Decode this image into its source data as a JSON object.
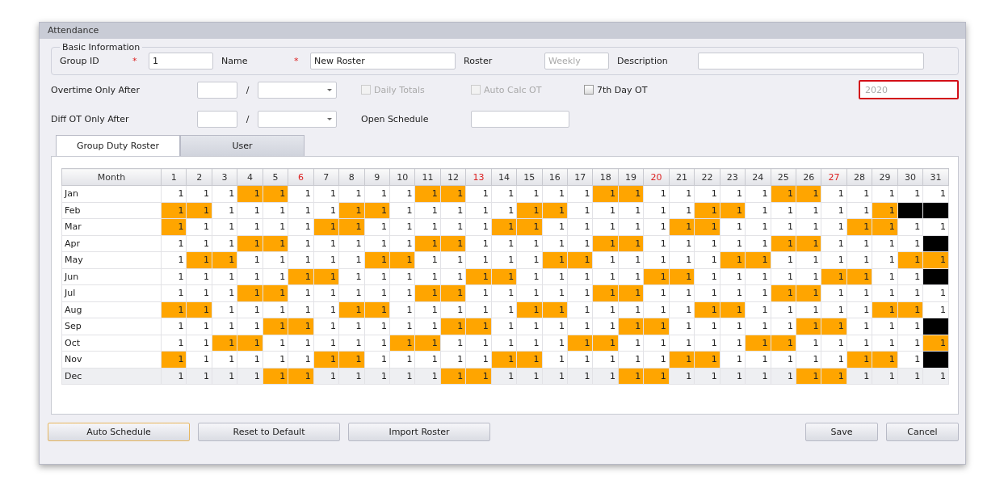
{
  "window": {
    "title": "Attendance"
  },
  "basic_information": {
    "legend": "Basic Information",
    "fields": [
      {
        "label": "Group ID",
        "required_mark": "*",
        "value": "1"
      },
      {
        "label": "Name",
        "required_mark": "*",
        "value": "New Roster"
      },
      {
        "label": "Roster",
        "placeholder": "Weekly"
      },
      {
        "label": "Description"
      }
    ]
  },
  "overtime_row": {
    "label": "Overtime Only After",
    "separator": "/",
    "checkboxes": [
      {
        "label": "Daily Totals",
        "checked": false,
        "disabled": true
      },
      {
        "label": "Auto Calc OT",
        "checked": false,
        "disabled": true
      },
      {
        "label": "7th Day OT",
        "checked": false,
        "disabled": false
      }
    ],
    "year_dropdown": {
      "value": "2020",
      "disabled": true,
      "highlighted": true
    }
  },
  "diff_ot_row": {
    "label": "Diff OT Only After",
    "separator": "/",
    "open_schedule_label": "Open Schedule"
  },
  "tabs": [
    {
      "label": "Group Duty Roster",
      "selected": true
    },
    {
      "label": "User",
      "selected": false
    }
  ],
  "roster_table": {
    "month_header": "Month",
    "days": [
      {
        "label": "1",
        "highlight": false
      },
      {
        "label": "2",
        "highlight": false
      },
      {
        "label": "3",
        "highlight": false
      },
      {
        "label": "4",
        "highlight": false
      },
      {
        "label": "5",
        "highlight": false
      },
      {
        "label": "6",
        "highlight": true
      },
      {
        "label": "7",
        "highlight": false
      },
      {
        "label": "8",
        "highlight": false
      },
      {
        "label": "9",
        "highlight": false
      },
      {
        "label": "10",
        "highlight": false
      },
      {
        "label": "11",
        "highlight": false
      },
      {
        "label": "12",
        "highlight": false
      },
      {
        "label": "13",
        "highlight": true
      },
      {
        "label": "14",
        "highlight": false
      },
      {
        "label": "15",
        "highlight": false
      },
      {
        "label": "16",
        "highlight": false
      },
      {
        "label": "17",
        "highlight": false
      },
      {
        "label": "18",
        "highlight": false
      },
      {
        "label": "19",
        "highlight": false
      },
      {
        "label": "20",
        "highlight": true
      },
      {
        "label": "21",
        "highlight": false
      },
      {
        "label": "22",
        "highlight": false
      },
      {
        "label": "23",
        "highlight": false
      },
      {
        "label": "24",
        "highlight": false
      },
      {
        "label": "25",
        "highlight": false
      },
      {
        "label": "26",
        "highlight": false
      },
      {
        "label": "27",
        "highlight": true
      },
      {
        "label": "28",
        "highlight": false
      },
      {
        "label": "29",
        "highlight": false
      },
      {
        "label": "30",
        "highlight": false
      },
      {
        "label": "31",
        "highlight": false
      }
    ],
    "rows": [
      {
        "month": "Jan",
        "selected": false,
        "cells": [
          {
            "text": "1",
            "kind": "work"
          },
          {
            "text": "1",
            "kind": "work"
          },
          {
            "text": "1",
            "kind": "work"
          },
          {
            "text": "1",
            "kind": "off"
          },
          {
            "text": "1",
            "kind": "off"
          },
          {
            "text": "1",
            "kind": "work"
          },
          {
            "text": "1",
            "kind": "work"
          },
          {
            "text": "1",
            "kind": "work"
          },
          {
            "text": "1",
            "kind": "work"
          },
          {
            "text": "1",
            "kind": "work"
          },
          {
            "text": "1",
            "kind": "off"
          },
          {
            "text": "1",
            "kind": "off"
          },
          {
            "text": "1",
            "kind": "work"
          },
          {
            "text": "1",
            "kind": "work"
          },
          {
            "text": "1",
            "kind": "work"
          },
          {
            "text": "1",
            "kind": "work"
          },
          {
            "text": "1",
            "kind": "work"
          },
          {
            "text": "1",
            "kind": "off"
          },
          {
            "text": "1",
            "kind": "off"
          },
          {
            "text": "1",
            "kind": "work"
          },
          {
            "text": "1",
            "kind": "work"
          },
          {
            "text": "1",
            "kind": "work"
          },
          {
            "text": "1",
            "kind": "work"
          },
          {
            "text": "1",
            "kind": "work"
          },
          {
            "text": "1",
            "kind": "off"
          },
          {
            "text": "1",
            "kind": "off"
          },
          {
            "text": "1",
            "kind": "work"
          },
          {
            "text": "1",
            "kind": "work"
          },
          {
            "text": "1",
            "kind": "work"
          },
          {
            "text": "1",
            "kind": "work"
          },
          {
            "text": "1",
            "kind": "work"
          }
        ]
      },
      {
        "month": "Feb",
        "selected": false,
        "cells": [
          {
            "text": "1",
            "kind": "off"
          },
          {
            "text": "1",
            "kind": "off"
          },
          {
            "text": "1",
            "kind": "work"
          },
          {
            "text": "1",
            "kind": "work"
          },
          {
            "text": "1",
            "kind": "work"
          },
          {
            "text": "1",
            "kind": "work"
          },
          {
            "text": "1",
            "kind": "work"
          },
          {
            "text": "1",
            "kind": "off"
          },
          {
            "text": "1",
            "kind": "off"
          },
          {
            "text": "1",
            "kind": "work"
          },
          {
            "text": "1",
            "kind": "work"
          },
          {
            "text": "1",
            "kind": "work"
          },
          {
            "text": "1",
            "kind": "work"
          },
          {
            "text": "1",
            "kind": "work"
          },
          {
            "text": "1",
            "kind": "off"
          },
          {
            "text": "1",
            "kind": "off"
          },
          {
            "text": "1",
            "kind": "work"
          },
          {
            "text": "1",
            "kind": "work"
          },
          {
            "text": "1",
            "kind": "work"
          },
          {
            "text": "1",
            "kind": "work"
          },
          {
            "text": "1",
            "kind": "work"
          },
          {
            "text": "1",
            "kind": "off"
          },
          {
            "text": "1",
            "kind": "off"
          },
          {
            "text": "1",
            "kind": "work"
          },
          {
            "text": "1",
            "kind": "work"
          },
          {
            "text": "1",
            "kind": "work"
          },
          {
            "text": "1",
            "kind": "work"
          },
          {
            "text": "1",
            "kind": "work"
          },
          {
            "text": "1",
            "kind": "off"
          },
          {
            "kind": "none"
          },
          {
            "kind": "none"
          }
        ]
      },
      {
        "month": "Mar",
        "selected": false,
        "cells": [
          {
            "text": "1",
            "kind": "off"
          },
          {
            "text": "1",
            "kind": "work"
          },
          {
            "text": "1",
            "kind": "work"
          },
          {
            "text": "1",
            "kind": "work"
          },
          {
            "text": "1",
            "kind": "work"
          },
          {
            "text": "1",
            "kind": "work"
          },
          {
            "text": "1",
            "kind": "off"
          },
          {
            "text": "1",
            "kind": "off"
          },
          {
            "text": "1",
            "kind": "work"
          },
          {
            "text": "1",
            "kind": "work"
          },
          {
            "text": "1",
            "kind": "work"
          },
          {
            "text": "1",
            "kind": "work"
          },
          {
            "text": "1",
            "kind": "work"
          },
          {
            "text": "1",
            "kind": "off"
          },
          {
            "text": "1",
            "kind": "off"
          },
          {
            "text": "1",
            "kind": "work"
          },
          {
            "text": "1",
            "kind": "work"
          },
          {
            "text": "1",
            "kind": "work"
          },
          {
            "text": "1",
            "kind": "work"
          },
          {
            "text": "1",
            "kind": "work"
          },
          {
            "text": "1",
            "kind": "off"
          },
          {
            "text": "1",
            "kind": "off"
          },
          {
            "text": "1",
            "kind": "work"
          },
          {
            "text": "1",
            "kind": "work"
          },
          {
            "text": "1",
            "kind": "work"
          },
          {
            "text": "1",
            "kind": "work"
          },
          {
            "text": "1",
            "kind": "work"
          },
          {
            "text": "1",
            "kind": "off"
          },
          {
            "text": "1",
            "kind": "off"
          },
          {
            "text": "1",
            "kind": "work"
          },
          {
            "text": "1",
            "kind": "work"
          }
        ]
      },
      {
        "month": "Apr",
        "selected": false,
        "cells": [
          {
            "text": "1",
            "kind": "work"
          },
          {
            "text": "1",
            "kind": "work"
          },
          {
            "text": "1",
            "kind": "work"
          },
          {
            "text": "1",
            "kind": "off"
          },
          {
            "text": "1",
            "kind": "off"
          },
          {
            "text": "1",
            "kind": "work"
          },
          {
            "text": "1",
            "kind": "work"
          },
          {
            "text": "1",
            "kind": "work"
          },
          {
            "text": "1",
            "kind": "work"
          },
          {
            "text": "1",
            "kind": "work"
          },
          {
            "text": "1",
            "kind": "off"
          },
          {
            "text": "1",
            "kind": "off"
          },
          {
            "text": "1",
            "kind": "work"
          },
          {
            "text": "1",
            "kind": "work"
          },
          {
            "text": "1",
            "kind": "work"
          },
          {
            "text": "1",
            "kind": "work"
          },
          {
            "text": "1",
            "kind": "work"
          },
          {
            "text": "1",
            "kind": "off"
          },
          {
            "text": "1",
            "kind": "off"
          },
          {
            "text": "1",
            "kind": "work"
          },
          {
            "text": "1",
            "kind": "work"
          },
          {
            "text": "1",
            "kind": "work"
          },
          {
            "text": "1",
            "kind": "work"
          },
          {
            "text": "1",
            "kind": "work"
          },
          {
            "text": "1",
            "kind": "off"
          },
          {
            "text": "1",
            "kind": "off"
          },
          {
            "text": "1",
            "kind": "work"
          },
          {
            "text": "1",
            "kind": "work"
          },
          {
            "text": "1",
            "kind": "work"
          },
          {
            "text": "1",
            "kind": "work"
          },
          {
            "kind": "none"
          }
        ]
      },
      {
        "month": "May",
        "selected": false,
        "cells": [
          {
            "text": "1",
            "kind": "work"
          },
          {
            "text": "1",
            "kind": "off"
          },
          {
            "text": "1",
            "kind": "off"
          },
          {
            "text": "1",
            "kind": "work"
          },
          {
            "text": "1",
            "kind": "work"
          },
          {
            "text": "1",
            "kind": "work"
          },
          {
            "text": "1",
            "kind": "work"
          },
          {
            "text": "1",
            "kind": "work"
          },
          {
            "text": "1",
            "kind": "off"
          },
          {
            "text": "1",
            "kind": "off"
          },
          {
            "text": "1",
            "kind": "work"
          },
          {
            "text": "1",
            "kind": "work"
          },
          {
            "text": "1",
            "kind": "work"
          },
          {
            "text": "1",
            "kind": "work"
          },
          {
            "text": "1",
            "kind": "work"
          },
          {
            "text": "1",
            "kind": "off"
          },
          {
            "text": "1",
            "kind": "off"
          },
          {
            "text": "1",
            "kind": "work"
          },
          {
            "text": "1",
            "kind": "work"
          },
          {
            "text": "1",
            "kind": "work"
          },
          {
            "text": "1",
            "kind": "work"
          },
          {
            "text": "1",
            "kind": "work"
          },
          {
            "text": "1",
            "kind": "off"
          },
          {
            "text": "1",
            "kind": "off"
          },
          {
            "text": "1",
            "kind": "work"
          },
          {
            "text": "1",
            "kind": "work"
          },
          {
            "text": "1",
            "kind": "work"
          },
          {
            "text": "1",
            "kind": "work"
          },
          {
            "text": "1",
            "kind": "work"
          },
          {
            "text": "1",
            "kind": "off"
          },
          {
            "text": "1",
            "kind": "off"
          }
        ]
      },
      {
        "month": "Jun",
        "selected": false,
        "cells": [
          {
            "text": "1",
            "kind": "work"
          },
          {
            "text": "1",
            "kind": "work"
          },
          {
            "text": "1",
            "kind": "work"
          },
          {
            "text": "1",
            "kind": "work"
          },
          {
            "text": "1",
            "kind": "work"
          },
          {
            "text": "1",
            "kind": "off"
          },
          {
            "text": "1",
            "kind": "off"
          },
          {
            "text": "1",
            "kind": "work"
          },
          {
            "text": "1",
            "kind": "work"
          },
          {
            "text": "1",
            "kind": "work"
          },
          {
            "text": "1",
            "kind": "work"
          },
          {
            "text": "1",
            "kind": "work"
          },
          {
            "text": "1",
            "kind": "off"
          },
          {
            "text": "1",
            "kind": "off"
          },
          {
            "text": "1",
            "kind": "work"
          },
          {
            "text": "1",
            "kind": "work"
          },
          {
            "text": "1",
            "kind": "work"
          },
          {
            "text": "1",
            "kind": "work"
          },
          {
            "text": "1",
            "kind": "work"
          },
          {
            "text": "1",
            "kind": "off"
          },
          {
            "text": "1",
            "kind": "off"
          },
          {
            "text": "1",
            "kind": "work"
          },
          {
            "text": "1",
            "kind": "work"
          },
          {
            "text": "1",
            "kind": "work"
          },
          {
            "text": "1",
            "kind": "work"
          },
          {
            "text": "1",
            "kind": "work"
          },
          {
            "text": "1",
            "kind": "off"
          },
          {
            "text": "1",
            "kind": "off"
          },
          {
            "text": "1",
            "kind": "work"
          },
          {
            "text": "1",
            "kind": "work"
          },
          {
            "kind": "none"
          }
        ]
      },
      {
        "month": "Jul",
        "selected": false,
        "cells": [
          {
            "text": "1",
            "kind": "work"
          },
          {
            "text": "1",
            "kind": "work"
          },
          {
            "text": "1",
            "kind": "work"
          },
          {
            "text": "1",
            "kind": "off"
          },
          {
            "text": "1",
            "kind": "off"
          },
          {
            "text": "1",
            "kind": "work"
          },
          {
            "text": "1",
            "kind": "work"
          },
          {
            "text": "1",
            "kind": "work"
          },
          {
            "text": "1",
            "kind": "work"
          },
          {
            "text": "1",
            "kind": "work"
          },
          {
            "text": "1",
            "kind": "off"
          },
          {
            "text": "1",
            "kind": "off"
          },
          {
            "text": "1",
            "kind": "work"
          },
          {
            "text": "1",
            "kind": "work"
          },
          {
            "text": "1",
            "kind": "work"
          },
          {
            "text": "1",
            "kind": "work"
          },
          {
            "text": "1",
            "kind": "work"
          },
          {
            "text": "1",
            "kind": "off"
          },
          {
            "text": "1",
            "kind": "off"
          },
          {
            "text": "1",
            "kind": "work"
          },
          {
            "text": "1",
            "kind": "work"
          },
          {
            "text": "1",
            "kind": "work"
          },
          {
            "text": "1",
            "kind": "work"
          },
          {
            "text": "1",
            "kind": "work"
          },
          {
            "text": "1",
            "kind": "off"
          },
          {
            "text": "1",
            "kind": "off"
          },
          {
            "text": "1",
            "kind": "work"
          },
          {
            "text": "1",
            "kind": "work"
          },
          {
            "text": "1",
            "kind": "work"
          },
          {
            "text": "1",
            "kind": "work"
          },
          {
            "text": "1",
            "kind": "work"
          }
        ]
      },
      {
        "month": "Aug",
        "selected": false,
        "cells": [
          {
            "text": "1",
            "kind": "off"
          },
          {
            "text": "1",
            "kind": "off"
          },
          {
            "text": "1",
            "kind": "work"
          },
          {
            "text": "1",
            "kind": "work"
          },
          {
            "text": "1",
            "kind": "work"
          },
          {
            "text": "1",
            "kind": "work"
          },
          {
            "text": "1",
            "kind": "work"
          },
          {
            "text": "1",
            "kind": "off"
          },
          {
            "text": "1",
            "kind": "off"
          },
          {
            "text": "1",
            "kind": "work"
          },
          {
            "text": "1",
            "kind": "work"
          },
          {
            "text": "1",
            "kind": "work"
          },
          {
            "text": "1",
            "kind": "work"
          },
          {
            "text": "1",
            "kind": "work"
          },
          {
            "text": "1",
            "kind": "off"
          },
          {
            "text": "1",
            "kind": "off"
          },
          {
            "text": "1",
            "kind": "work"
          },
          {
            "text": "1",
            "kind": "work"
          },
          {
            "text": "1",
            "kind": "work"
          },
          {
            "text": "1",
            "kind": "work"
          },
          {
            "text": "1",
            "kind": "work"
          },
          {
            "text": "1",
            "kind": "off"
          },
          {
            "text": "1",
            "kind": "off"
          },
          {
            "text": "1",
            "kind": "work"
          },
          {
            "text": "1",
            "kind": "work"
          },
          {
            "text": "1",
            "kind": "work"
          },
          {
            "text": "1",
            "kind": "work"
          },
          {
            "text": "1",
            "kind": "work"
          },
          {
            "text": "1",
            "kind": "off"
          },
          {
            "text": "1",
            "kind": "off"
          },
          {
            "text": "1",
            "kind": "work"
          }
        ]
      },
      {
        "month": "Sep",
        "selected": false,
        "cells": [
          {
            "text": "1",
            "kind": "work"
          },
          {
            "text": "1",
            "kind": "work"
          },
          {
            "text": "1",
            "kind": "work"
          },
          {
            "text": "1",
            "kind": "work"
          },
          {
            "text": "1",
            "kind": "off"
          },
          {
            "text": "1",
            "kind": "off"
          },
          {
            "text": "1",
            "kind": "work"
          },
          {
            "text": "1",
            "kind": "work"
          },
          {
            "text": "1",
            "kind": "work"
          },
          {
            "text": "1",
            "kind": "work"
          },
          {
            "text": "1",
            "kind": "work"
          },
          {
            "text": "1",
            "kind": "off"
          },
          {
            "text": "1",
            "kind": "off"
          },
          {
            "text": "1",
            "kind": "work"
          },
          {
            "text": "1",
            "kind": "work"
          },
          {
            "text": "1",
            "kind": "work"
          },
          {
            "text": "1",
            "kind": "work"
          },
          {
            "text": "1",
            "kind": "work"
          },
          {
            "text": "1",
            "kind": "off"
          },
          {
            "text": "1",
            "kind": "off"
          },
          {
            "text": "1",
            "kind": "work"
          },
          {
            "text": "1",
            "kind": "work"
          },
          {
            "text": "1",
            "kind": "work"
          },
          {
            "text": "1",
            "kind": "work"
          },
          {
            "text": "1",
            "kind": "work"
          },
          {
            "text": "1",
            "kind": "off"
          },
          {
            "text": "1",
            "kind": "off"
          },
          {
            "text": "1",
            "kind": "work"
          },
          {
            "text": "1",
            "kind": "work"
          },
          {
            "text": "1",
            "kind": "work"
          },
          {
            "kind": "none"
          }
        ]
      },
      {
        "month": "Oct",
        "selected": false,
        "cells": [
          {
            "text": "1",
            "kind": "work"
          },
          {
            "text": "1",
            "kind": "work"
          },
          {
            "text": "1",
            "kind": "off"
          },
          {
            "text": "1",
            "kind": "off"
          },
          {
            "text": "1",
            "kind": "work"
          },
          {
            "text": "1",
            "kind": "work"
          },
          {
            "text": "1",
            "kind": "work"
          },
          {
            "text": "1",
            "kind": "work"
          },
          {
            "text": "1",
            "kind": "work"
          },
          {
            "text": "1",
            "kind": "off"
          },
          {
            "text": "1",
            "kind": "off"
          },
          {
            "text": "1",
            "kind": "work"
          },
          {
            "text": "1",
            "kind": "work"
          },
          {
            "text": "1",
            "kind": "work"
          },
          {
            "text": "1",
            "kind": "work"
          },
          {
            "text": "1",
            "kind": "work"
          },
          {
            "text": "1",
            "kind": "off"
          },
          {
            "text": "1",
            "kind": "off"
          },
          {
            "text": "1",
            "kind": "work"
          },
          {
            "text": "1",
            "kind": "work"
          },
          {
            "text": "1",
            "kind": "work"
          },
          {
            "text": "1",
            "kind": "work"
          },
          {
            "text": "1",
            "kind": "work"
          },
          {
            "text": "1",
            "kind": "off"
          },
          {
            "text": "1",
            "kind": "off"
          },
          {
            "text": "1",
            "kind": "work"
          },
          {
            "text": "1",
            "kind": "work"
          },
          {
            "text": "1",
            "kind": "work"
          },
          {
            "text": "1",
            "kind": "work"
          },
          {
            "text": "1",
            "kind": "work"
          },
          {
            "text": "1",
            "kind": "off"
          }
        ]
      },
      {
        "month": "Nov",
        "selected": false,
        "cells": [
          {
            "text": "1",
            "kind": "off"
          },
          {
            "text": "1",
            "kind": "work"
          },
          {
            "text": "1",
            "kind": "work"
          },
          {
            "text": "1",
            "kind": "work"
          },
          {
            "text": "1",
            "kind": "work"
          },
          {
            "text": "1",
            "kind": "work"
          },
          {
            "text": "1",
            "kind": "off"
          },
          {
            "text": "1",
            "kind": "off"
          },
          {
            "text": "1",
            "kind": "work"
          },
          {
            "text": "1",
            "kind": "work"
          },
          {
            "text": "1",
            "kind": "work"
          },
          {
            "text": "1",
            "kind": "work"
          },
          {
            "text": "1",
            "kind": "work"
          },
          {
            "text": "1",
            "kind": "off"
          },
          {
            "text": "1",
            "kind": "off"
          },
          {
            "text": "1",
            "kind": "work"
          },
          {
            "text": "1",
            "kind": "work"
          },
          {
            "text": "1",
            "kind": "work"
          },
          {
            "text": "1",
            "kind": "work"
          },
          {
            "text": "1",
            "kind": "work"
          },
          {
            "text": "1",
            "kind": "off"
          },
          {
            "text": "1",
            "kind": "off"
          },
          {
            "text": "1",
            "kind": "work"
          },
          {
            "text": "1",
            "kind": "work"
          },
          {
            "text": "1",
            "kind": "work"
          },
          {
            "text": "1",
            "kind": "work"
          },
          {
            "text": "1",
            "kind": "work"
          },
          {
            "text": "1",
            "kind": "off"
          },
          {
            "text": "1",
            "kind": "off"
          },
          {
            "text": "1",
            "kind": "work"
          },
          {
            "kind": "none"
          }
        ]
      },
      {
        "month": "Dec",
        "selected": true,
        "cells": [
          {
            "text": "1",
            "kind": "work"
          },
          {
            "text": "1",
            "kind": "work"
          },
          {
            "text": "1",
            "kind": "work"
          },
          {
            "text": "1",
            "kind": "work"
          },
          {
            "text": "1",
            "kind": "off"
          },
          {
            "text": "1",
            "kind": "off"
          },
          {
            "text": "1",
            "kind": "work"
          },
          {
            "text": "1",
            "kind": "work"
          },
          {
            "text": "1",
            "kind": "work"
          },
          {
            "text": "1",
            "kind": "work"
          },
          {
            "text": "1",
            "kind": "work"
          },
          {
            "text": "1",
            "kind": "off"
          },
          {
            "text": "1",
            "kind": "off"
          },
          {
            "text": "1",
            "kind": "work"
          },
          {
            "text": "1",
            "kind": "work"
          },
          {
            "text": "1",
            "kind": "work"
          },
          {
            "text": "1",
            "kind": "work"
          },
          {
            "text": "1",
            "kind": "work"
          },
          {
            "text": "1",
            "kind": "off"
          },
          {
            "text": "1",
            "kind": "off"
          },
          {
            "text": "1",
            "kind": "work"
          },
          {
            "text": "1",
            "kind": "work"
          },
          {
            "text": "1",
            "kind": "work"
          },
          {
            "text": "1",
            "kind": "work"
          },
          {
            "text": "1",
            "kind": "work"
          },
          {
            "text": "1",
            "kind": "off"
          },
          {
            "text": "1",
            "kind": "off"
          },
          {
            "text": "1",
            "kind": "work"
          },
          {
            "text": "1",
            "kind": "work"
          },
          {
            "text": "1",
            "kind": "work"
          },
          {
            "text": "1",
            "kind": "work"
          }
        ]
      }
    ]
  },
  "buttons_left": [
    {
      "label": "Auto Schedule",
      "focused": true
    },
    {
      "label": "Reset to Default",
      "focused": false
    },
    {
      "label": "Import Roster",
      "focused": false
    }
  ],
  "buttons_right": [
    {
      "label": "Save",
      "focused": false
    },
    {
      "label": "Cancel",
      "focused": false
    }
  ]
}
